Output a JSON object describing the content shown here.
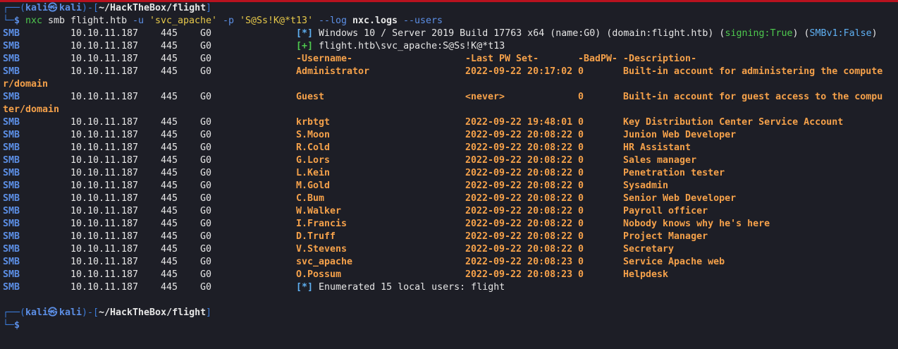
{
  "prompt": {
    "user": "kali",
    "at_symbol": "㉿",
    "host": "kali",
    "path": "~/HackTheBox/flight",
    "dollar": "$"
  },
  "command": {
    "bin": "nxc",
    "args1": " smb flight.htb ",
    "flag_u": "-u",
    "user_arg": "'svc_apache'",
    "flag_p": "-p",
    "pass_arg": "'S@Ss!K@*t13'",
    "flag_log": "--log",
    "log_file": "nxc.logs",
    "flag_users": "--users"
  },
  "proto": "SMB",
  "ip": "10.10.11.187",
  "port": "445",
  "hostname": "G0",
  "info_line": {
    "marker": "[*]",
    "text": " Windows 10 / Server 2019 Build 17763 x64 (name:G0) (domain:flight.htb) (",
    "signing": "signing:True",
    "mid": ") (",
    "smbv1": "SMBv1:False",
    "end": ")"
  },
  "auth_line": {
    "marker": "[+]",
    "text": " flight.htb\\svc_apache:S@Ss!K@*t13"
  },
  "headers": {
    "username": "-Username-",
    "last_pw": "-Last PW Set-",
    "badpw": "-BadPW-",
    "description": "-Description-"
  },
  "users": [
    {
      "username": "Administrator",
      "last_pw": "2022-09-22 20:17:02",
      "badpw": "0",
      "desc": "Built-in account for administering the compute",
      "wrap": "r/domain"
    },
    {
      "username": "Guest",
      "last_pw": "<never>",
      "badpw": "0",
      "desc": "Built-in account for guest access to the compu",
      "wrap": "ter/domain"
    },
    {
      "username": "krbtgt",
      "last_pw": "2022-09-22 19:48:01",
      "badpw": "0",
      "desc": "Key Distribution Center Service Account"
    },
    {
      "username": "S.Moon",
      "last_pw": "2022-09-22 20:08:22",
      "badpw": "0",
      "desc": "Junion Web Developer"
    },
    {
      "username": "R.Cold",
      "last_pw": "2022-09-22 20:08:22",
      "badpw": "0",
      "desc": "HR Assistant"
    },
    {
      "username": "G.Lors",
      "last_pw": "2022-09-22 20:08:22",
      "badpw": "0",
      "desc": "Sales manager"
    },
    {
      "username": "L.Kein",
      "last_pw": "2022-09-22 20:08:22",
      "badpw": "0",
      "desc": "Penetration tester"
    },
    {
      "username": "M.Gold",
      "last_pw": "2022-09-22 20:08:22",
      "badpw": "0",
      "desc": "Sysadmin"
    },
    {
      "username": "C.Bum",
      "last_pw": "2022-09-22 20:08:22",
      "badpw": "0",
      "desc": "Senior Web Developer"
    },
    {
      "username": "W.Walker",
      "last_pw": "2022-09-22 20:08:22",
      "badpw": "0",
      "desc": "Payroll officer"
    },
    {
      "username": "I.Francis",
      "last_pw": "2022-09-22 20:08:22",
      "badpw": "0",
      "desc": "Nobody knows why he's here"
    },
    {
      "username": "D.Truff",
      "last_pw": "2022-09-22 20:08:22",
      "badpw": "0",
      "desc": "Project Manager"
    },
    {
      "username": "V.Stevens",
      "last_pw": "2022-09-22 20:08:22",
      "badpw": "0",
      "desc": "Secretary"
    },
    {
      "username": "svc_apache",
      "last_pw": "2022-09-22 20:08:23",
      "badpw": "0",
      "desc": "Service Apache web"
    },
    {
      "username": "O.Possum",
      "last_pw": "2022-09-22 20:08:23",
      "badpw": "0",
      "desc": "Helpdesk"
    }
  ],
  "summary": {
    "marker": "[*]",
    "text": " Enumerated 15 local users: flight"
  }
}
